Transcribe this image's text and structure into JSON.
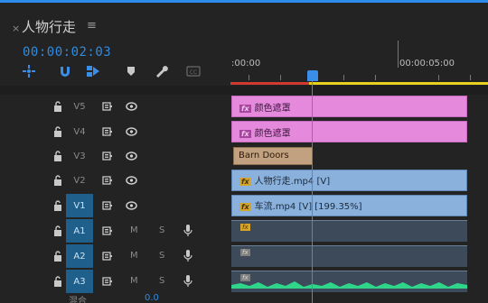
{
  "tab": {
    "close": "×",
    "title": "人物行走",
    "menu": "≡"
  },
  "timecode": "00:00:02:03",
  "ruler": {
    "start_label": ":00:00",
    "end_label": "00:00:05:00"
  },
  "video_tracks": [
    {
      "name": "V5"
    },
    {
      "name": "V4"
    },
    {
      "name": "V3"
    },
    {
      "name": "V2"
    },
    {
      "name": "V1"
    }
  ],
  "audio_tracks": [
    {
      "name": "A1",
      "m": "M",
      "s": "S"
    },
    {
      "name": "A2",
      "m": "M",
      "s": "S"
    },
    {
      "name": "A3",
      "m": "M",
      "s": "S"
    }
  ],
  "clips": {
    "v5": {
      "fx": "fx",
      "label": "颜色遮罩"
    },
    "v4": {
      "fx": "fx",
      "label": "颜色遮罩"
    },
    "v3": {
      "label": "Barn Doors"
    },
    "v2": {
      "fx": "fx",
      "label": "人物行走.mp4 [V]"
    },
    "v1": {
      "fx": "fx",
      "label": "车流.mp4 [V] [199.35%]"
    },
    "a1": {
      "fx": "fx"
    },
    "a2": {
      "fx": "fx"
    },
    "a3": {
      "fx": "fx"
    }
  },
  "partial_row": {
    "label": "混合",
    "value": "0.0"
  },
  "colors": {
    "accent": "#2d8ceb",
    "color_matte_clip": "#e489dc",
    "video_clip": "#8ab0dc",
    "transition_clip": "#c2a181",
    "audio_wave": "#2fd68a"
  }
}
